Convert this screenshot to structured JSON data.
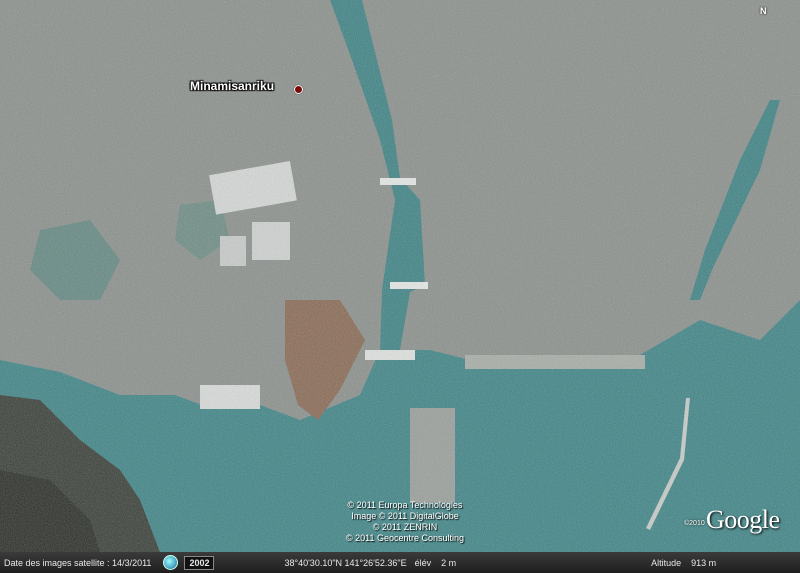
{
  "map": {
    "place_label": "Minamisanriku",
    "north_indicator": "N",
    "credits": [
      "© 2011 Europa Technologies",
      "Image © 2011 DigitalGlobe",
      "© 2011 ZENRIN",
      "© 2011 Geocentre Consulting"
    ],
    "logo_year": "©2010",
    "logo_text": "Google",
    "icons": {
      "place_marker": "red-dot-pin",
      "imagery_date": "clock-icon"
    }
  },
  "status_bar": {
    "imagery_date": "Date des images satellite : 14/3/2011",
    "year_button": "2002",
    "coordinates": "38°40'30.10\"N 141°26'52.36\"E",
    "elevation_label": "élév",
    "elevation_value": "2 m",
    "altitude_label": "Altitude",
    "altitude_value": "913 m"
  }
}
